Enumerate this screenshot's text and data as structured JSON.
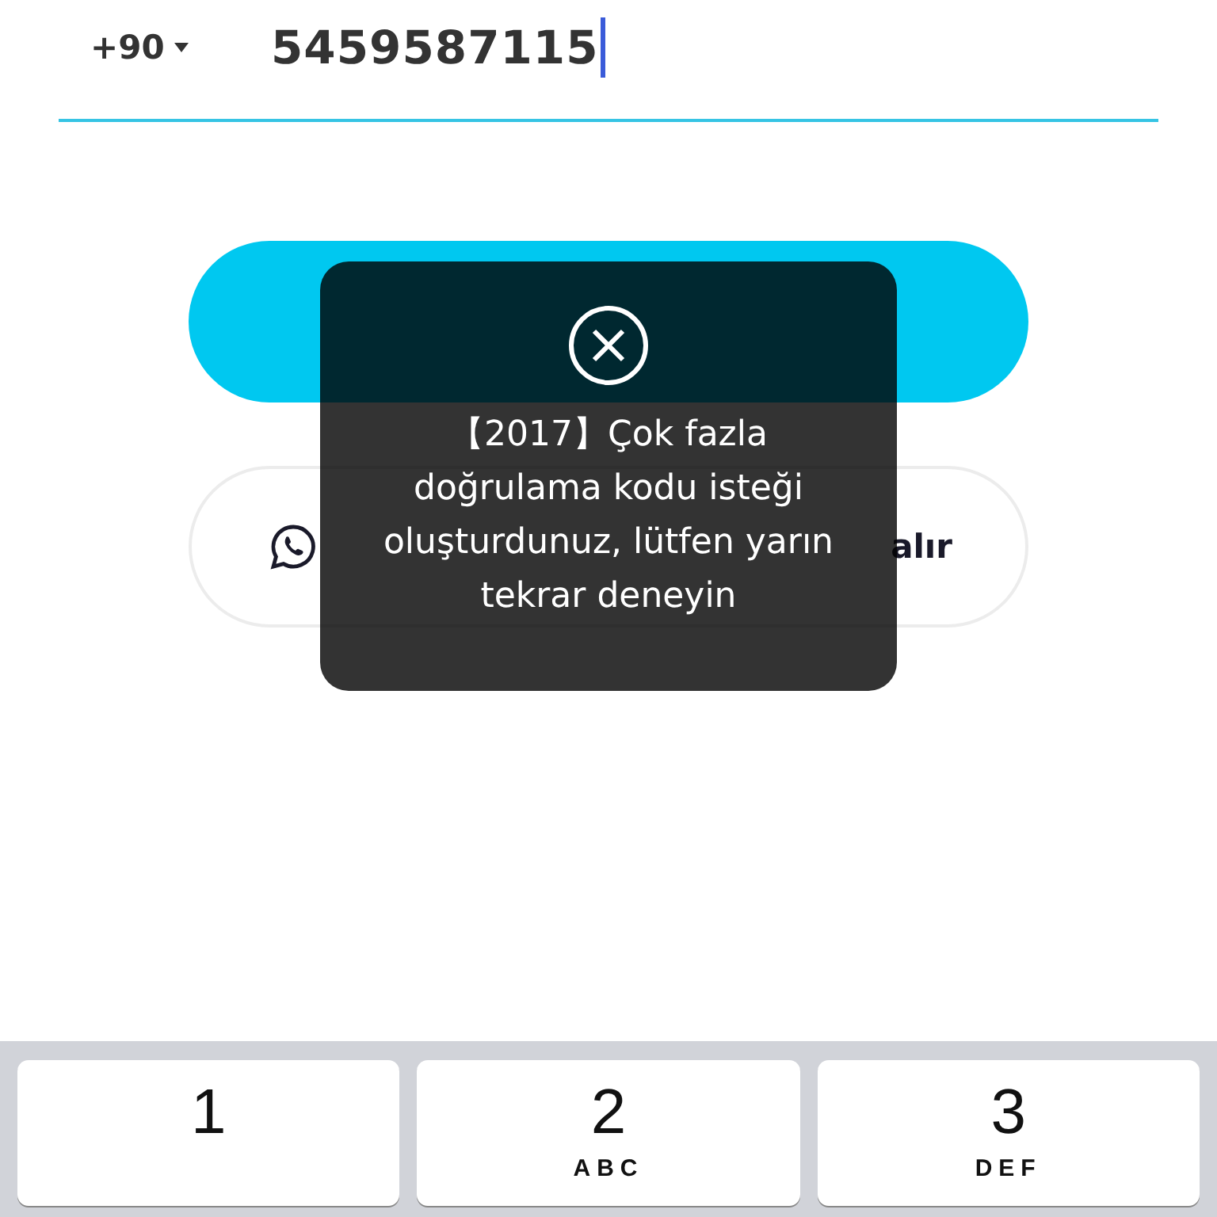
{
  "phone_input": {
    "country_code": "+90",
    "value": "5459587115"
  },
  "buttons": [
    {
      "kind": "primary"
    },
    {
      "kind": "whatsapp",
      "label": "alır"
    }
  ],
  "toast": {
    "message": "【2017】Çok fazla doğrulama kodu isteği oluşturdunuz, lütfen yarın tekrar deneyin"
  },
  "keyboard": {
    "keys": [
      {
        "digit": "1"
      },
      {
        "digit": "2",
        "letters": "ABC"
      },
      {
        "digit": "3",
        "letters": "DEF"
      }
    ]
  }
}
